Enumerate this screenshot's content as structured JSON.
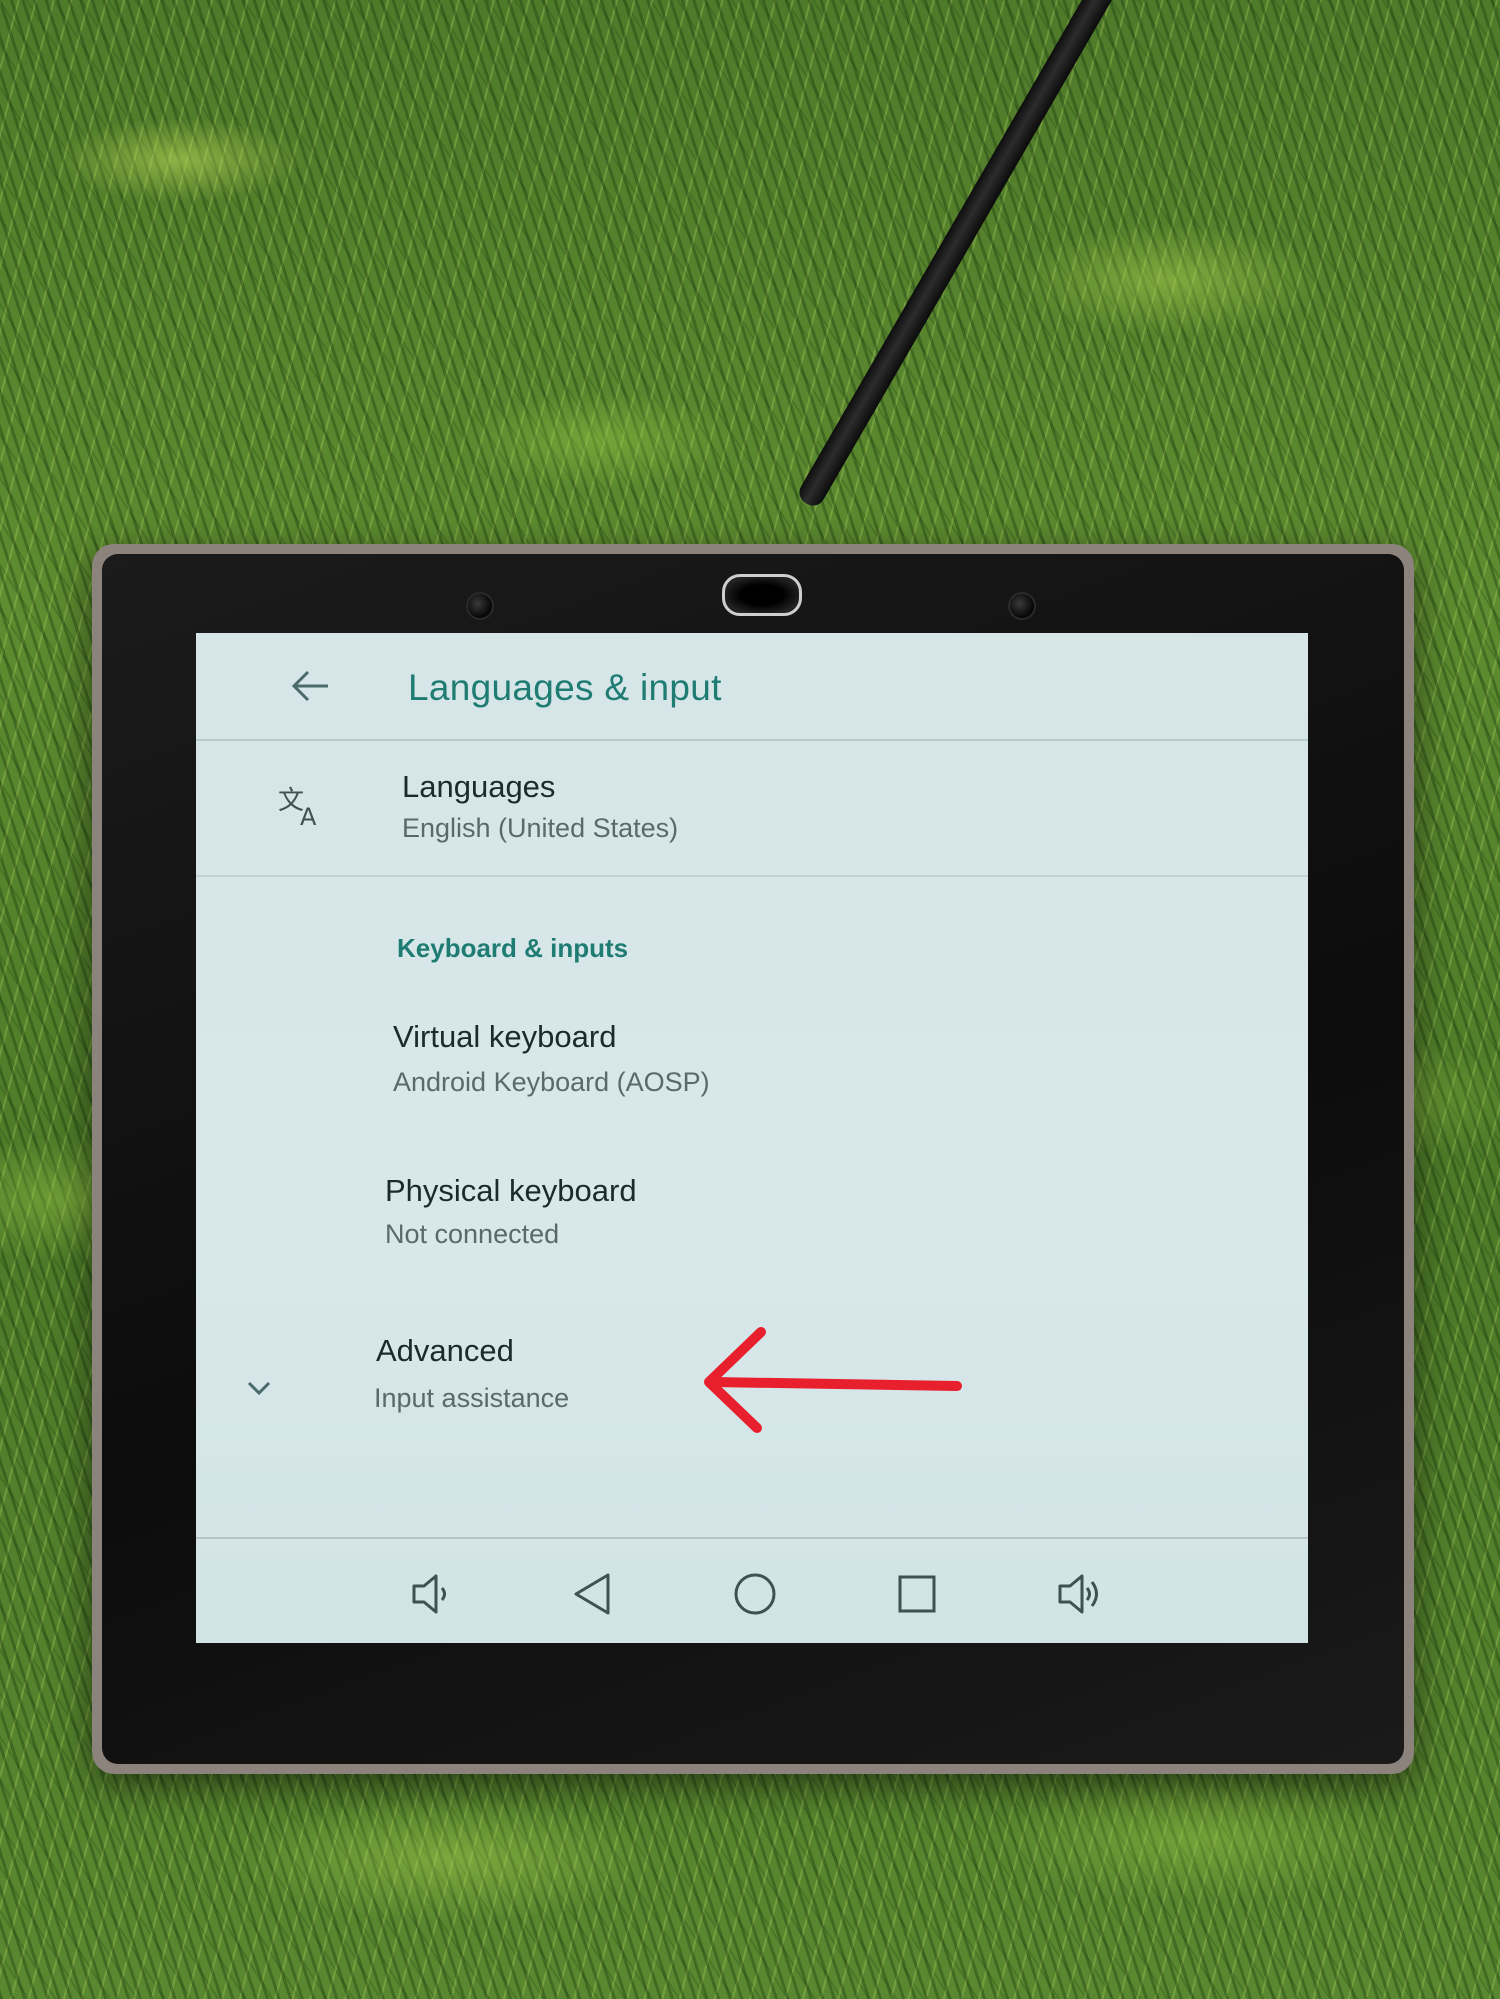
{
  "app_bar": {
    "title": "Languages & input"
  },
  "languages": {
    "icon": "translate-icon",
    "title": "Languages",
    "summary": "English (United States)"
  },
  "section": {
    "header": "Keyboard & inputs"
  },
  "virtual_keyboard": {
    "title": "Virtual keyboard",
    "summary": "Android Keyboard (AOSP)"
  },
  "physical_keyboard": {
    "title": "Physical keyboard",
    "summary": "Not connected"
  },
  "advanced": {
    "title": "Advanced",
    "summary": "Input assistance",
    "icon": "chevron-down-icon"
  },
  "nav_bar": {
    "buttons": [
      "volume-down-icon",
      "back-icon",
      "home-icon",
      "recents-icon",
      "volume-up-icon"
    ]
  },
  "colors": {
    "accent": "#1f7c73",
    "annotation": "#e8202e"
  }
}
